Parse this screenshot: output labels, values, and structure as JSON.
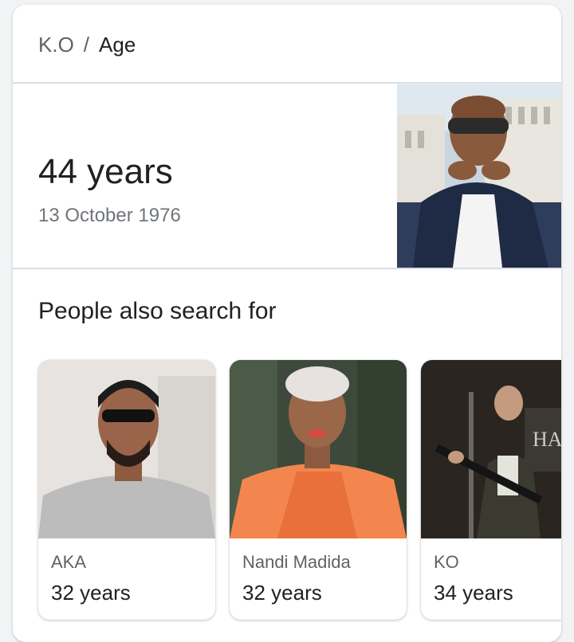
{
  "breadcrumb": {
    "entity": "K.O",
    "separator": "/",
    "attribute": "Age"
  },
  "answer": {
    "value": "44 years",
    "date": "13 October 1976"
  },
  "related": {
    "title": "People also search for",
    "people": [
      {
        "name": "AKA",
        "age": "32 years"
      },
      {
        "name": "Nandi Madida",
        "age": "32 years"
      },
      {
        "name": "KO",
        "age": "34 years"
      }
    ]
  },
  "colors": {
    "background": "#f1f3f4",
    "card": "#ffffff",
    "secondary_text": "#5f6368",
    "primary_text": "#202124",
    "divider": "#dadce0"
  }
}
